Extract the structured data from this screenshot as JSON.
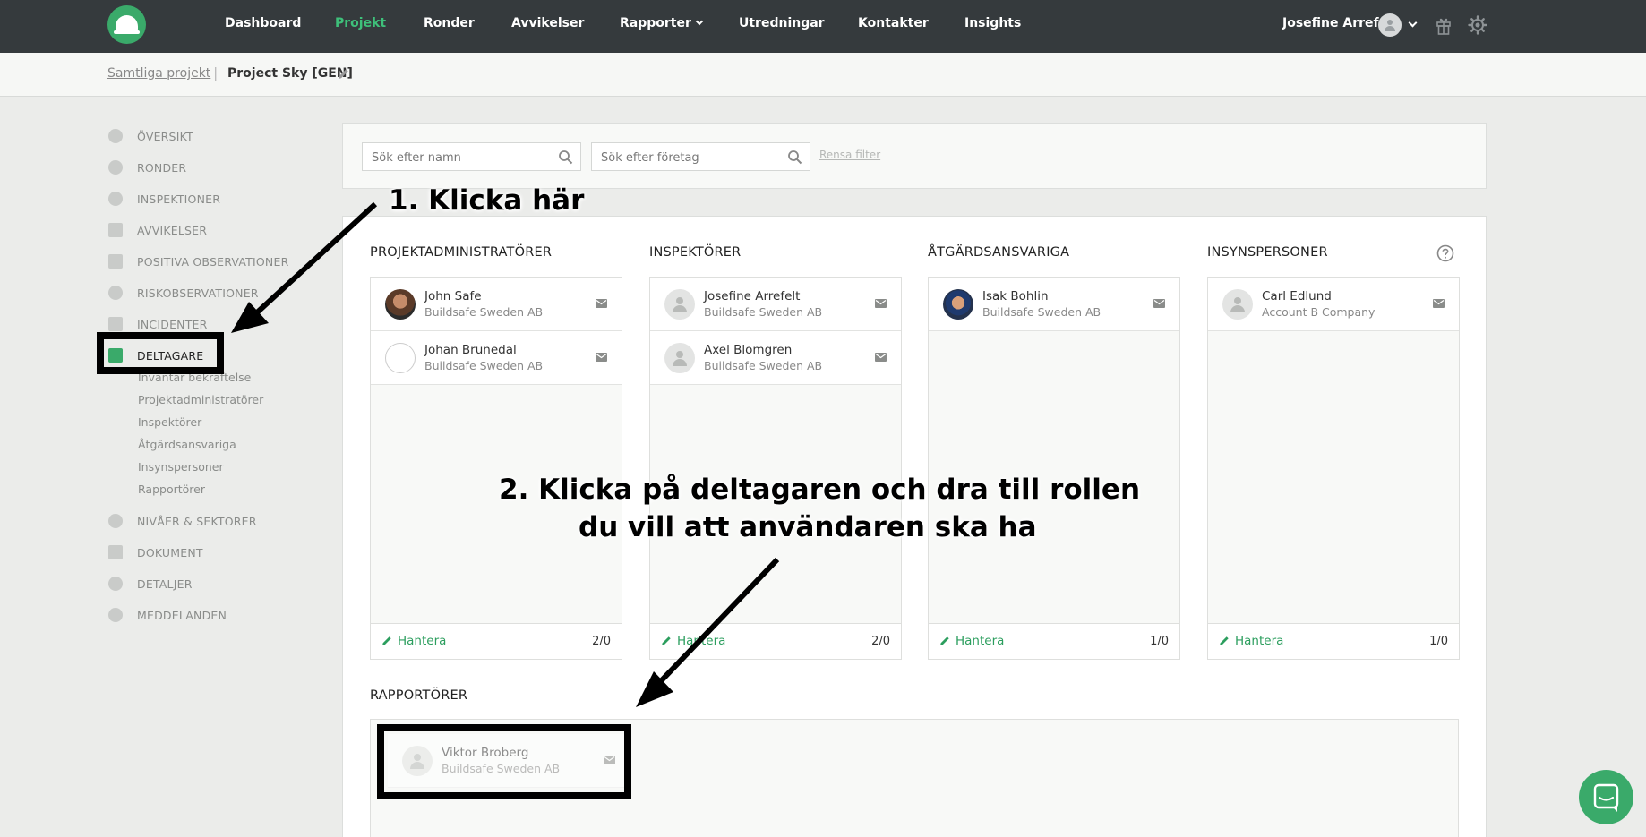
{
  "nav": {
    "items": [
      "Dashboard",
      "Projekt",
      "Ronder",
      "Avvikelser",
      "Rapporter",
      "Utredningar",
      "Kontakter",
      "Insights"
    ],
    "user": "Josefine Arrefelt"
  },
  "breadcrumb": {
    "root": "Samtliga projekt",
    "separator": "|",
    "current": "Project Sky [GEN]"
  },
  "sidebar": {
    "items": [
      "ÖVERSIKT",
      "RONDER",
      "INSPEKTIONER",
      "AVVIKELSER",
      "POSITIVA OBSERVATIONER",
      "RISKOBSERVATIONER",
      "INCIDENTER",
      "DELTAGARE",
      "NIVÅER & SEKTORER",
      "DOKUMENT",
      "DETALJER",
      "MEDDELANDEN"
    ],
    "subitems": [
      "Inväntar bekräftelse",
      "Projektadministratörer",
      "Inspektörer",
      "Åtgärdsansvariga",
      "Insynspersoner",
      "Rapportörer"
    ]
  },
  "filters": {
    "name_placeholder": "Sök efter namn",
    "company_placeholder": "Sök efter företag",
    "clear": "Rensa filter"
  },
  "columns": [
    {
      "title": "PROJEKTADMINISTRATÖRER",
      "count": "2/0",
      "people": [
        {
          "name": "John Safe",
          "company": "Buildsafe Sweden AB"
        },
        {
          "name": "Johan Brunedal",
          "company": "Buildsafe Sweden AB"
        }
      ]
    },
    {
      "title": "INSPEKTÖRER",
      "count": "2/0",
      "people": [
        {
          "name": "Josefine Arrefelt",
          "company": "Buildsafe Sweden AB"
        },
        {
          "name": "Axel Blomgren",
          "company": "Buildsafe Sweden AB"
        }
      ]
    },
    {
      "title": "ÅTGÄRDSANSVARIGA",
      "count": "1/0",
      "people": [
        {
          "name": "Isak Bohlin",
          "company": "Buildsafe Sweden AB"
        }
      ]
    },
    {
      "title": "INSYNSPERSONER",
      "count": "1/0",
      "people": [
        {
          "name": "Carl Edlund",
          "company": "Account B Company"
        }
      ]
    }
  ],
  "manage_label": "Hantera",
  "reporters": {
    "title": "RAPPORTÖRER",
    "people": [
      {
        "name": "Viktor Broberg",
        "company": "Buildsafe Sweden AB"
      }
    ]
  },
  "annotations": {
    "step1": "1. Klicka här",
    "step2_line1": "2. Klicka på deltagaren och dra till rollen",
    "step2_line2": "du vill att användaren ska ha"
  },
  "colors": {
    "topbar": "#353a3d",
    "accent": "#3aaa6a",
    "active_nav": "#3ec07a"
  }
}
